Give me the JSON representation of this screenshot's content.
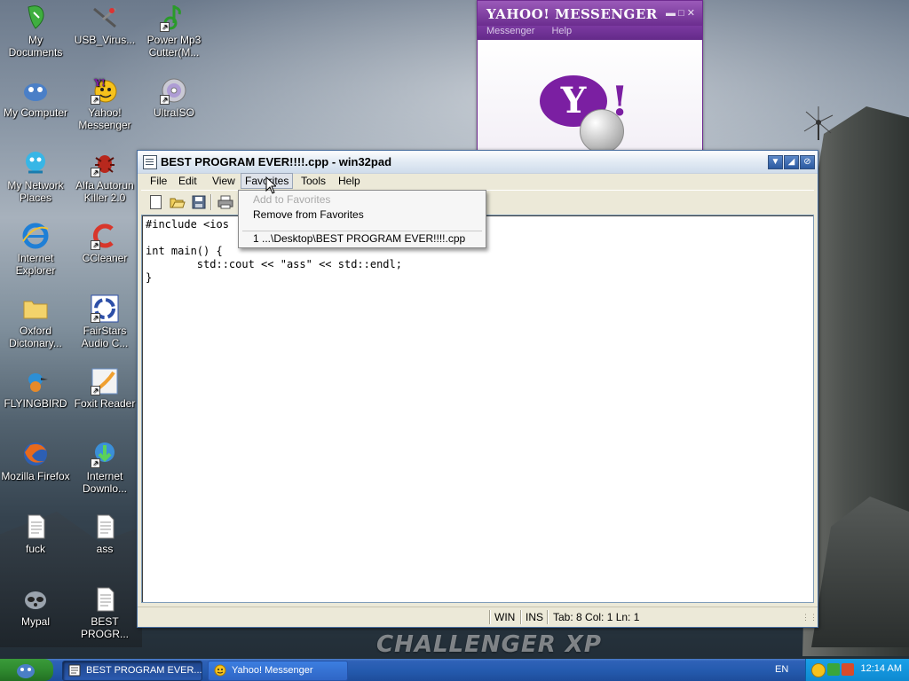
{
  "desktop": {
    "watermark": "CHALLENGER XP",
    "icons": [
      {
        "label": "My Documents"
      },
      {
        "label": "USB_Virus..."
      },
      {
        "label": "Power Mp3 Cutter(M..."
      },
      {
        "label": "My Computer"
      },
      {
        "label": "Yahoo! Messenger"
      },
      {
        "label": "UltraISO"
      },
      {
        "label": "My Network Places"
      },
      {
        "label": "Alfa Autorun Killer 2.0"
      },
      {
        "label": "Internet Explorer"
      },
      {
        "label": "CCleaner"
      },
      {
        "label": "Oxford Dictonary..."
      },
      {
        "label": "FairStars Audio C..."
      },
      {
        "label": "FLYINGBIRD"
      },
      {
        "label": "Foxit Reader"
      },
      {
        "label": "Mozilla Firefox"
      },
      {
        "label": "Internet Downlo..."
      },
      {
        "label": "fuck"
      },
      {
        "label": "ass"
      },
      {
        "label": "Mypal"
      },
      {
        "label": "BEST PROGR..."
      }
    ]
  },
  "yahoo": {
    "title": "YAHOO! MESSENGER",
    "menu": [
      "Messenger",
      "Help"
    ],
    "logo_letter": "Y",
    "logo_mark": "!"
  },
  "pad": {
    "title": "BEST PROGRAM EVER!!!!.cpp - win32pad",
    "menu": [
      "File",
      "Edit",
      "View",
      "Favorites",
      "Tools",
      "Help"
    ],
    "code": "#include <ios\n\nint main() {\n        std::cout << \"ass\" << std::endl;\n}",
    "status": {
      "mode": "WIN",
      "ins": "INS",
      "position": "Tab: 8 Col: 1 Ln: 1"
    }
  },
  "favorites_menu": {
    "add": "Add to Favorites",
    "remove": "Remove from Favorites",
    "recent": "1 ...\\Desktop\\BEST PROGRAM EVER!!!!.cpp"
  },
  "taskbar": {
    "tasks": [
      {
        "label": "BEST PROGRAM EVER..."
      },
      {
        "label": "Yahoo! Messenger"
      }
    ],
    "language": "EN",
    "clock": "12:14 AM"
  }
}
